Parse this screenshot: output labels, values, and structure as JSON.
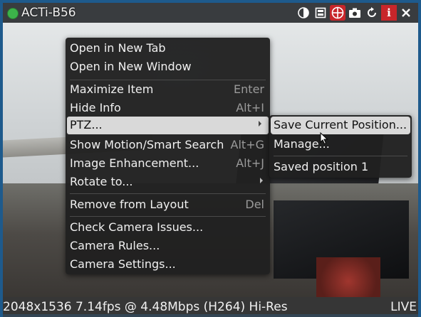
{
  "window": {
    "title": "ACTi-B56",
    "status_color": "#3cb34a",
    "toolbar_icons": [
      "contrast-icon",
      "layout-icon",
      "ptz-target-icon",
      "screenshot-icon",
      "rotate-icon",
      "info-icon",
      "close-icon"
    ]
  },
  "status_bar": {
    "stream_info": "2048x1536 7.14fps @ 4.48Mbps (H264) Hi-Res",
    "live": "LIVE"
  },
  "context_menu": {
    "items": [
      {
        "label": "Open in New Tab",
        "shortcut": ""
      },
      {
        "label": "Open in New Window",
        "shortcut": ""
      },
      {
        "label": "Maximize Item",
        "shortcut": "Enter"
      },
      {
        "label": "Hide Info",
        "shortcut": "Alt+I"
      },
      {
        "label": "PTZ...",
        "shortcut": ""
      },
      {
        "label": "Show Motion/Smart Search",
        "shortcut": "Alt+G"
      },
      {
        "label": "Image Enhancement...",
        "shortcut": "Alt+J"
      },
      {
        "label": "Rotate to...",
        "shortcut": ""
      },
      {
        "label": "Remove from Layout",
        "shortcut": "Del"
      },
      {
        "label": "Check Camera Issues...",
        "shortcut": ""
      },
      {
        "label": "Camera Rules...",
        "shortcut": ""
      },
      {
        "label": "Camera Settings...",
        "shortcut": ""
      }
    ]
  },
  "ptz_submenu": {
    "items": [
      {
        "label": "Save Current Position..."
      },
      {
        "label": "Manage..."
      },
      {
        "label": "Saved position 1"
      }
    ]
  }
}
